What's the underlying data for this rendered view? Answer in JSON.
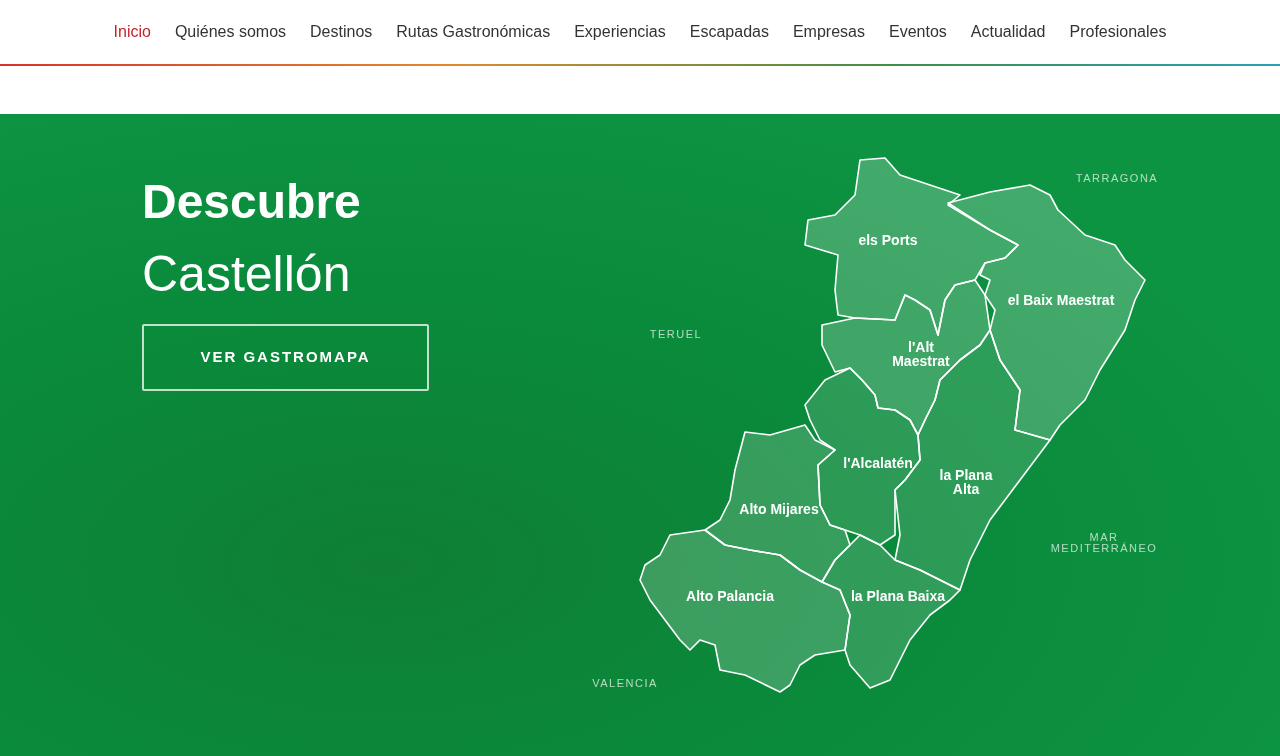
{
  "nav": [
    {
      "label": "Inicio",
      "selected": true
    },
    {
      "label": "Quiénes somos",
      "selected": false
    },
    {
      "label": "Destinos",
      "selected": false
    },
    {
      "label": "Rutas Gastronómicas",
      "selected": false
    },
    {
      "label": "Experiencias",
      "selected": false
    },
    {
      "label": "Escapadas",
      "selected": false
    },
    {
      "label": "Empresas",
      "selected": false
    },
    {
      "label": "Eventos",
      "selected": false
    },
    {
      "label": "Actualidad",
      "selected": false
    },
    {
      "label": "Profesionales",
      "selected": false
    }
  ],
  "hero": {
    "title": "Descubre",
    "subtitle": "Castellón",
    "button": "VER GASTROMAPA"
  },
  "map": {
    "regions": [
      {
        "lines": [
          "els Ports"
        ]
      },
      {
        "lines": [
          "el Baix Maestrat"
        ]
      },
      {
        "lines": [
          "l'Alt",
          "Maestrat"
        ]
      },
      {
        "lines": [
          "l'Alcalatén"
        ]
      },
      {
        "lines": [
          "la Plana",
          "Alta"
        ]
      },
      {
        "lines": [
          "Alto Mijares"
        ]
      },
      {
        "lines": [
          "Alto Palancia"
        ]
      },
      {
        "lines": [
          "la Plana Baixa"
        ]
      }
    ],
    "surroundings": [
      {
        "lines": [
          "TARRAGONA"
        ]
      },
      {
        "lines": [
          "TERUEL"
        ]
      },
      {
        "lines": [
          "MAR",
          "MEDITERRÁNEO"
        ]
      },
      {
        "lines": [
          "VALENCIA"
        ]
      }
    ]
  }
}
